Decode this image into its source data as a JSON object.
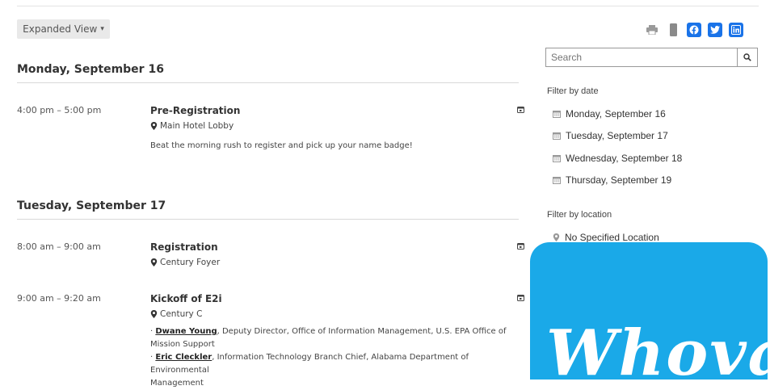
{
  "toolbar": {
    "view_label": "Expanded View",
    "view_caret": "▾"
  },
  "share": {
    "icons": [
      "print-icon",
      "mobile-icon",
      "facebook-icon",
      "twitter-icon",
      "linkedin-icon"
    ],
    "colors": {
      "gray": "#9a9a9a",
      "brand": "#1a73e8"
    }
  },
  "days": [
    {
      "header": "Monday, September 16",
      "events": [
        {
          "time": "4:00 pm – 5:00 pm",
          "title": "Pre-Registration",
          "location": "Main Hotel Lobby",
          "description": "Beat the morning rush to register and pick up your name badge!"
        }
      ]
    },
    {
      "header": "Tuesday, September 17",
      "events": [
        {
          "time": "8:00 am – 9:00 am",
          "title": "Registration",
          "location": "Century Foyer"
        },
        {
          "time": "9:00 am – 9:20 am",
          "title": "Kickoff of E2i",
          "location": "Century C",
          "speakers": [
            {
              "name": "Dwane Young",
              "role": ", Deputy Director, Office of Information Management, U.S. EPA Office of Mission Support"
            },
            {
              "name": "Eric Cleckler",
              "role": ", Information Technology Branch Chief, Alabama Department of Environmental"
            },
            {
              "name": "",
              "role": "Management"
            }
          ]
        }
      ]
    }
  ],
  "sidebar": {
    "search_placeholder": "Search",
    "filter_date_label": "Filter by date",
    "dates": [
      "Monday, September 16",
      "Tuesday, September 17",
      "Wednesday, September 18",
      "Thursday, September 19"
    ],
    "filter_location_label": "Filter by location",
    "locations": [
      "No Specified Location"
    ]
  },
  "promo": {
    "text": "Whova",
    "bg_color": "#1aa9e8"
  }
}
